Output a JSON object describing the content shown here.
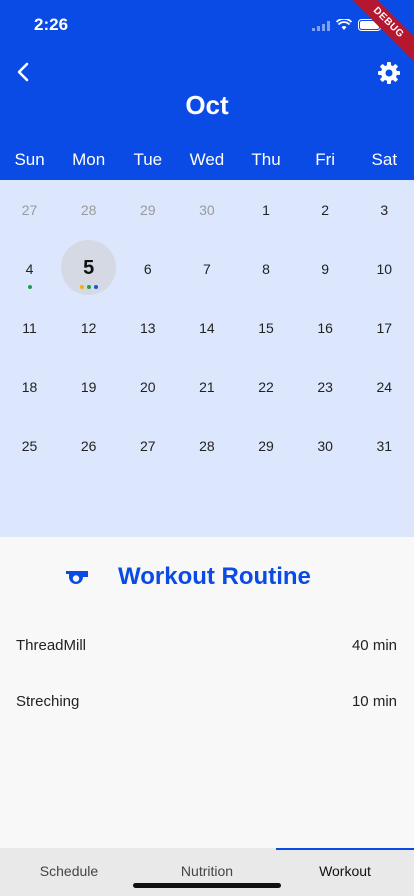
{
  "status": {
    "time": "2:26",
    "debug_label": "DEBUG"
  },
  "header": {
    "month": "Oct",
    "back_icon": "chevron-left-icon",
    "settings_icon": "gear-icon",
    "weekdays": [
      "Sun",
      "Mon",
      "Tue",
      "Wed",
      "Thu",
      "Fri",
      "Sat"
    ]
  },
  "calendar": {
    "weeks": [
      [
        {
          "d": "27",
          "muted": true
        },
        {
          "d": "28",
          "muted": true
        },
        {
          "d": "29",
          "muted": true
        },
        {
          "d": "30",
          "muted": true
        },
        {
          "d": "1"
        },
        {
          "d": "2"
        },
        {
          "d": "3"
        }
      ],
      [
        {
          "d": "4",
          "dots": [
            "#18a34a"
          ]
        },
        {
          "d": "5",
          "selected": true,
          "dots": [
            "#f2b300",
            "#18a34a",
            "#1f4fe0"
          ]
        },
        {
          "d": "6"
        },
        {
          "d": "7"
        },
        {
          "d": "8"
        },
        {
          "d": "9"
        },
        {
          "d": "10"
        }
      ],
      [
        {
          "d": "11"
        },
        {
          "d": "12"
        },
        {
          "d": "13"
        },
        {
          "d": "14"
        },
        {
          "d": "15"
        },
        {
          "d": "16"
        },
        {
          "d": "17"
        }
      ],
      [
        {
          "d": "18"
        },
        {
          "d": "19"
        },
        {
          "d": "20"
        },
        {
          "d": "21"
        },
        {
          "d": "22"
        },
        {
          "d": "23"
        },
        {
          "d": "24"
        }
      ],
      [
        {
          "d": "25"
        },
        {
          "d": "26"
        },
        {
          "d": "27"
        },
        {
          "d": "28"
        },
        {
          "d": "29"
        },
        {
          "d": "30"
        },
        {
          "d": "31"
        }
      ]
    ]
  },
  "routine": {
    "icon": "whistle-icon",
    "title": "Workout Routine",
    "items": [
      {
        "name": "ThreadMill",
        "duration": "40 min"
      },
      {
        "name": "Streching",
        "duration": "10 min"
      }
    ]
  },
  "tabs": {
    "items": [
      "Schedule",
      "Nutrition",
      "Workout"
    ],
    "active": "Workout"
  },
  "colors": {
    "primary": "#0a4be6",
    "calendar_bg": "#dce7fd"
  }
}
